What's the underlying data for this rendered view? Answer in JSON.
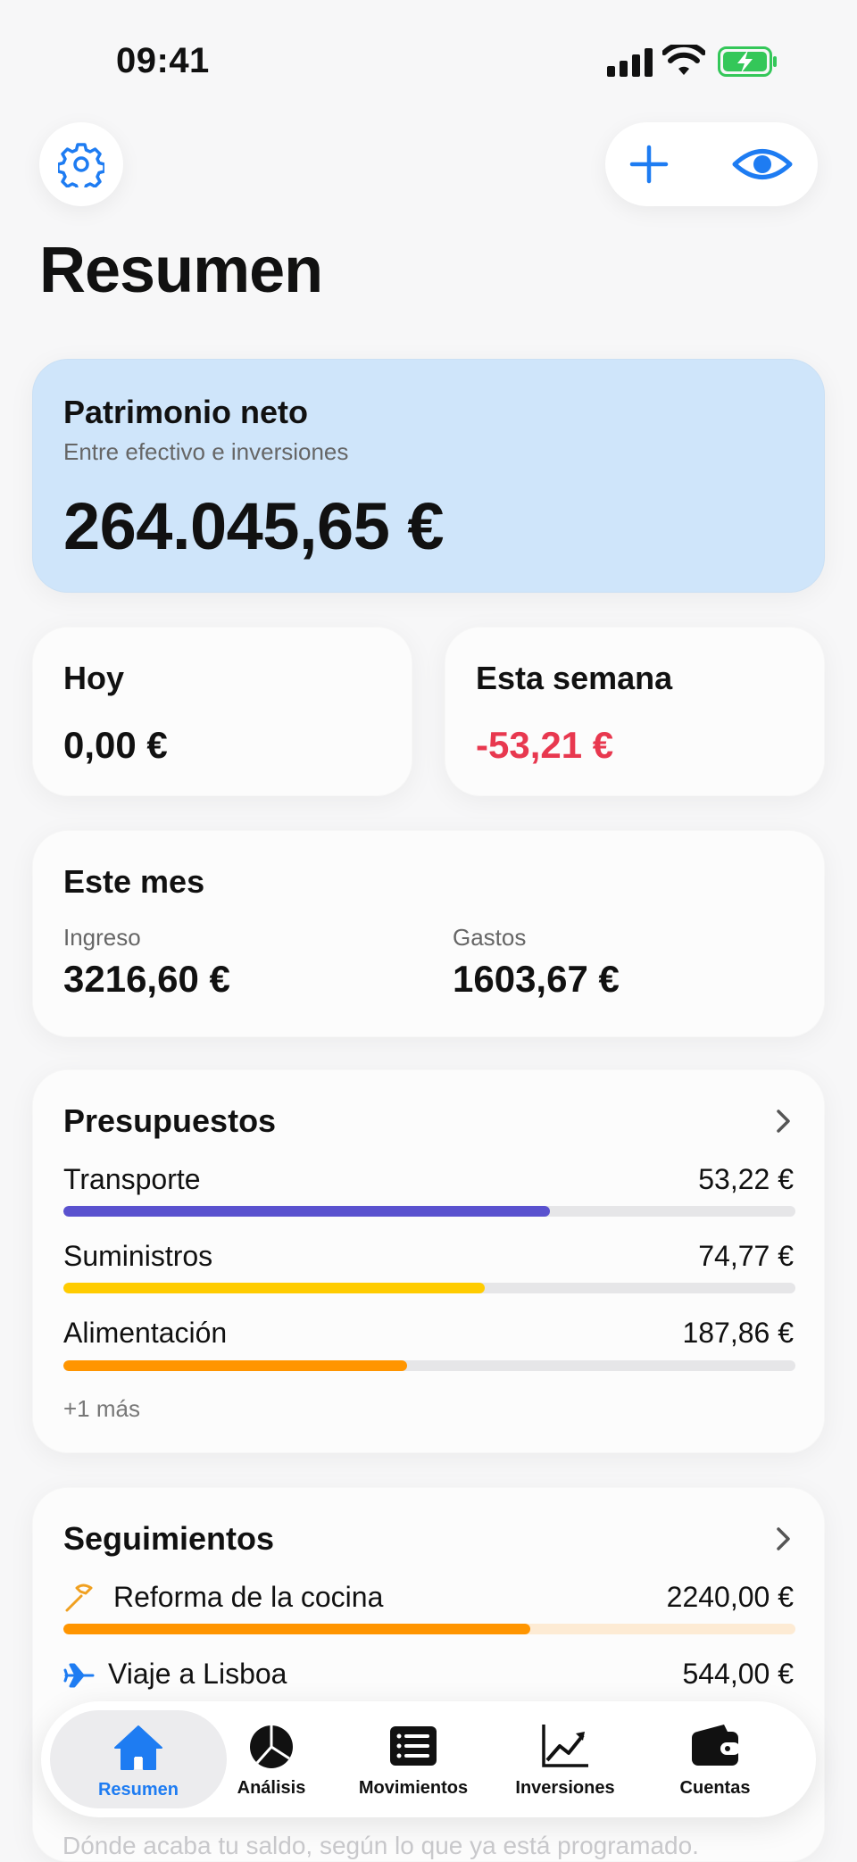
{
  "status_bar": {
    "time": "09:41"
  },
  "header": {
    "title": "Resumen"
  },
  "net_worth": {
    "title": "Patrimonio neto",
    "subtitle": "Entre efectivo e inversiones",
    "amount": "264.045,65 €"
  },
  "today": {
    "title": "Hoy",
    "amount": "0,00 €"
  },
  "week": {
    "title": "Esta semana",
    "amount": "-53,21 €"
  },
  "month": {
    "title": "Este mes",
    "income_label": "Ingreso",
    "income": "3216,60 €",
    "expenses_label": "Gastos",
    "expenses": "1603,67 €"
  },
  "budgets": {
    "title": "Presupuestos",
    "items": [
      {
        "label": "Transporte",
        "value": "53,22 €",
        "progress": 0.665,
        "color": "#5a52cf"
      },
      {
        "label": "Suministros",
        "value": "74,77 €",
        "progress": 0.575,
        "color": "#ffcc00"
      },
      {
        "label": "Alimentación",
        "value": "187,86 €",
        "progress": 0.47,
        "color": "#ff9500"
      }
    ],
    "more": "+1 más"
  },
  "tracking": {
    "title": "Seguimientos",
    "items": [
      {
        "label": "Reforma de la cocina",
        "value": "2240,00 €",
        "icon": "hammer-icon",
        "progress": 0.638,
        "color": "#ff9500"
      },
      {
        "label": "Viaje a Lisboa",
        "value": "544,00 €",
        "icon": "airplane-icon"
      }
    ]
  },
  "faded_text": "Dónde acaba tu saldo, según lo que ya está programado.",
  "tabbar": {
    "tabs": [
      {
        "label": "Resumen",
        "icon": "house-icon",
        "active": true
      },
      {
        "label": "Análisis",
        "icon": "pie-chart-icon"
      },
      {
        "label": "Movimientos",
        "icon": "list-icon"
      },
      {
        "label": "Inversiones",
        "icon": "line-chart-icon"
      },
      {
        "label": "Cuentas",
        "icon": "wallet-icon"
      }
    ]
  },
  "colors": {
    "accent": "#1e7cf2",
    "negative": "#e8384f",
    "card_highlight": "#cfe5fa"
  }
}
